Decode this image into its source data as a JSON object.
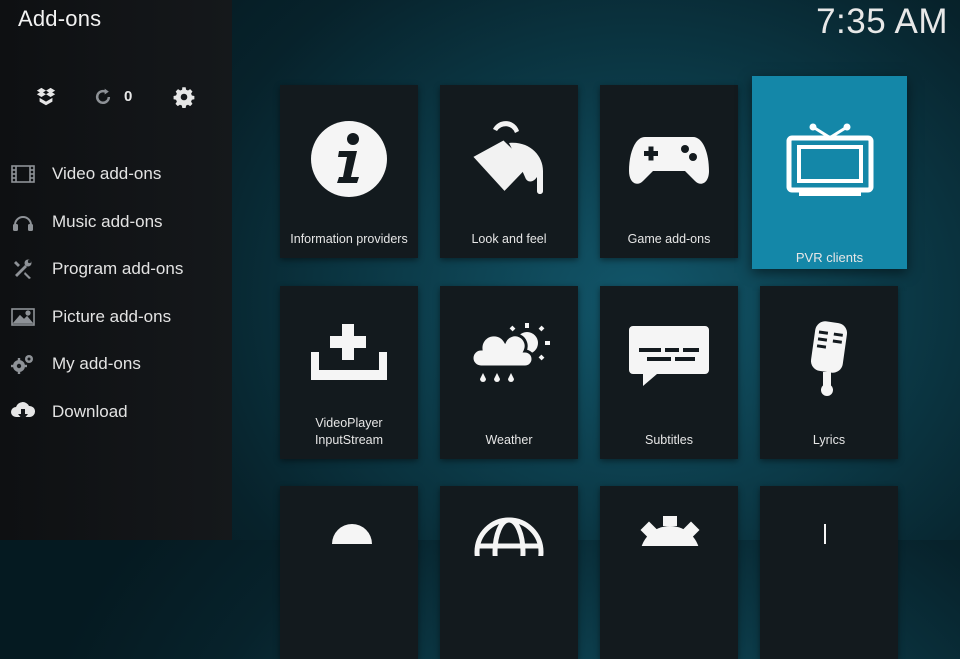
{
  "header": {
    "title": "Add-ons",
    "clock": "7:35 AM"
  },
  "toolbar": {
    "install_icon": "dropbox-box-icon",
    "update_icon": "refresh-icon",
    "update_count": "0",
    "settings_icon": "gear-icon"
  },
  "sidebar": {
    "items": [
      {
        "label": "Video add-ons",
        "icon": "film-strip-icon"
      },
      {
        "label": "Music add-ons",
        "icon": "headphones-icon"
      },
      {
        "label": "Program add-ons",
        "icon": "tools-icon"
      },
      {
        "label": "Picture add-ons",
        "icon": "picture-icon"
      },
      {
        "label": "My add-ons",
        "icon": "gears-icon"
      },
      {
        "label": "Download",
        "icon": "cloud-download-icon"
      }
    ]
  },
  "grid": {
    "tiles": [
      {
        "label": "Information providers",
        "icon": "info-icon"
      },
      {
        "label": "Look and feel",
        "icon": "paint-bucket-icon"
      },
      {
        "label": "Game add-ons",
        "icon": "gamepad-icon"
      },
      {
        "label": "PVR clients",
        "icon": "tv-icon",
        "focused": true
      },
      {
        "label": "VideoPlayer\nInputStream",
        "icon": "input-add-icon"
      },
      {
        "label": "Weather",
        "icon": "weather-icon"
      },
      {
        "label": "Subtitles",
        "icon": "subtitles-icon"
      },
      {
        "label": "Lyrics",
        "icon": "microphone-icon"
      }
    ]
  },
  "colors": {
    "accent": "#1487a8",
    "tile": "#131a1e",
    "sidebar": "#15181b"
  }
}
